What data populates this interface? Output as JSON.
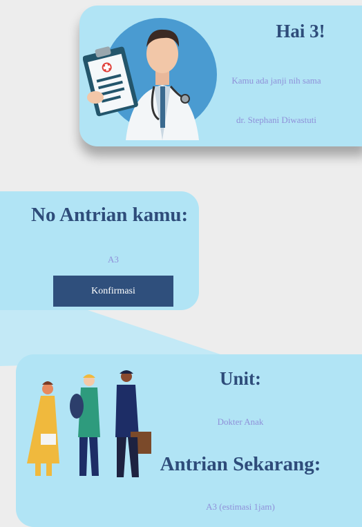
{
  "greeting_card": {
    "greeting": "Hai 3!",
    "appointment_text": "Kamu ada janji nih sama",
    "doctor_name": "dr. Stephani Diwastuti"
  },
  "queue_card": {
    "title": "No Antrian kamu:",
    "number": "A3",
    "confirm_label": "Konfirmasi"
  },
  "unit_card": {
    "unit_title": "Unit:",
    "unit_value": "Dokter Anak",
    "current_title": "Antrian Sekarang:",
    "current_value": "A3 (estimasi 1jam)"
  },
  "colors": {
    "card_bg": "#b1e4f5",
    "heading": "#2e4c7a",
    "muted_text": "#8f90d9",
    "button_bg": "#2f4f7c",
    "page_bg": "#ededed"
  }
}
